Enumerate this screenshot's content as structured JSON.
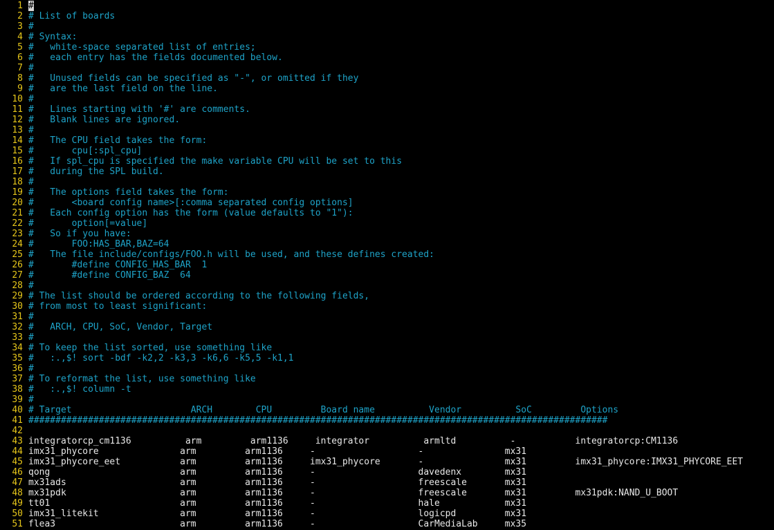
{
  "editor": {
    "colors": {
      "background": "#000000",
      "line_number": "#e6c61a",
      "comment": "#1ea3c8",
      "text": "#e8e8e8"
    },
    "lines": [
      {
        "n": "1",
        "text": "#",
        "kind": "comment",
        "cursor": true
      },
      {
        "n": "2",
        "text": "# List of boards",
        "kind": "comment"
      },
      {
        "n": "3",
        "text": "#",
        "kind": "comment"
      },
      {
        "n": "4",
        "text": "# Syntax:",
        "kind": "comment"
      },
      {
        "n": "5",
        "text": "#   white-space separated list of entries;",
        "kind": "comment"
      },
      {
        "n": "6",
        "text": "#   each entry has the fields documented below.",
        "kind": "comment"
      },
      {
        "n": "7",
        "text": "#",
        "kind": "comment"
      },
      {
        "n": "8",
        "text": "#   Unused fields can be specified as \"-\", or omitted if they",
        "kind": "comment"
      },
      {
        "n": "9",
        "text": "#   are the last field on the line.",
        "kind": "comment"
      },
      {
        "n": "10",
        "text": "#",
        "kind": "comment"
      },
      {
        "n": "11",
        "text": "#   Lines starting with '#' are comments.",
        "kind": "comment"
      },
      {
        "n": "12",
        "text": "#   Blank lines are ignored.",
        "kind": "comment"
      },
      {
        "n": "13",
        "text": "#",
        "kind": "comment"
      },
      {
        "n": "14",
        "text": "#   The CPU field takes the form:",
        "kind": "comment"
      },
      {
        "n": "15",
        "text": "#       cpu[:spl_cpu]",
        "kind": "comment"
      },
      {
        "n": "16",
        "text": "#   If spl_cpu is specified the make variable CPU will be set to this",
        "kind": "comment"
      },
      {
        "n": "17",
        "text": "#   during the SPL build.",
        "kind": "comment"
      },
      {
        "n": "18",
        "text": "#",
        "kind": "comment"
      },
      {
        "n": "19",
        "text": "#   The options field takes the form:",
        "kind": "comment"
      },
      {
        "n": "20",
        "text": "#       <board config name>[:comma separated config options]",
        "kind": "comment"
      },
      {
        "n": "21",
        "text": "#   Each config option has the form (value defaults to \"1\"):",
        "kind": "comment"
      },
      {
        "n": "22",
        "text": "#       option[=value]",
        "kind": "comment"
      },
      {
        "n": "23",
        "text": "#   So if you have:",
        "kind": "comment"
      },
      {
        "n": "24",
        "text": "#       FOO:HAS_BAR,BAZ=64",
        "kind": "comment"
      },
      {
        "n": "25",
        "text": "#   The file include/configs/FOO.h will be used, and these defines created:",
        "kind": "comment"
      },
      {
        "n": "26",
        "text": "#       #define CONFIG_HAS_BAR  1",
        "kind": "comment"
      },
      {
        "n": "27",
        "text": "#       #define CONFIG_BAZ  64",
        "kind": "comment"
      },
      {
        "n": "28",
        "text": "#",
        "kind": "comment"
      },
      {
        "n": "29",
        "text": "# The list should be ordered according to the following fields,",
        "kind": "comment"
      },
      {
        "n": "30",
        "text": "# from most to least significant:",
        "kind": "comment"
      },
      {
        "n": "31",
        "text": "#",
        "kind": "comment"
      },
      {
        "n": "32",
        "text": "#   ARCH, CPU, SoC, Vendor, Target",
        "kind": "comment"
      },
      {
        "n": "33",
        "text": "#",
        "kind": "comment"
      },
      {
        "n": "34",
        "text": "# To keep the list sorted, use something like",
        "kind": "comment"
      },
      {
        "n": "35",
        "text": "#   :.,$! sort -bdf -k2,2 -k3,3 -k6,6 -k5,5 -k1,1",
        "kind": "comment"
      },
      {
        "n": "36",
        "text": "#",
        "kind": "comment"
      },
      {
        "n": "37",
        "text": "# To reformat the list, use something like",
        "kind": "comment"
      },
      {
        "n": "38",
        "text": "#   :.,$! column -t",
        "kind": "comment"
      },
      {
        "n": "39",
        "text": "#",
        "kind": "comment"
      },
      {
        "n": "40",
        "text": "# Target                      ARCH        CPU         Board name          Vendor          SoC         Options",
        "kind": "comment"
      },
      {
        "n": "41",
        "text": "###########################################################################################################",
        "kind": "comment"
      },
      {
        "n": "42",
        "text": "",
        "kind": "data"
      },
      {
        "n": "43",
        "text": "integratorcp_cm1136          arm         arm1136     integrator          armltd          -           integratorcp:CM1136",
        "kind": "data"
      },
      {
        "n": "44",
        "text": "imx31_phycore               arm         arm1136     -                   -               mx31",
        "kind": "data"
      },
      {
        "n": "45",
        "text": "imx31_phycore_eet           arm         arm1136     imx31_phycore       -               mx31         imx31_phycore:IMX31_PHYCORE_EET",
        "kind": "data"
      },
      {
        "n": "46",
        "text": "qong                        arm         arm1136     -                   davedenx        mx31",
        "kind": "data"
      },
      {
        "n": "47",
        "text": "mx31ads                     arm         arm1136     -                   freescale       mx31",
        "kind": "data"
      },
      {
        "n": "48",
        "text": "mx31pdk                     arm         arm1136     -                   freescale       mx31         mx31pdk:NAND_U_BOOT",
        "kind": "data"
      },
      {
        "n": "49",
        "text": "tt01                        arm         arm1136     -                   hale            mx31",
        "kind": "data"
      },
      {
        "n": "50",
        "text": "imx31_litekit               arm         arm1136     -                   logicpd         mx31",
        "kind": "data"
      },
      {
        "n": "51",
        "text": "flea3                       arm         arm1136     -                   CarMediaLab     mx35",
        "kind": "data"
      }
    ]
  }
}
